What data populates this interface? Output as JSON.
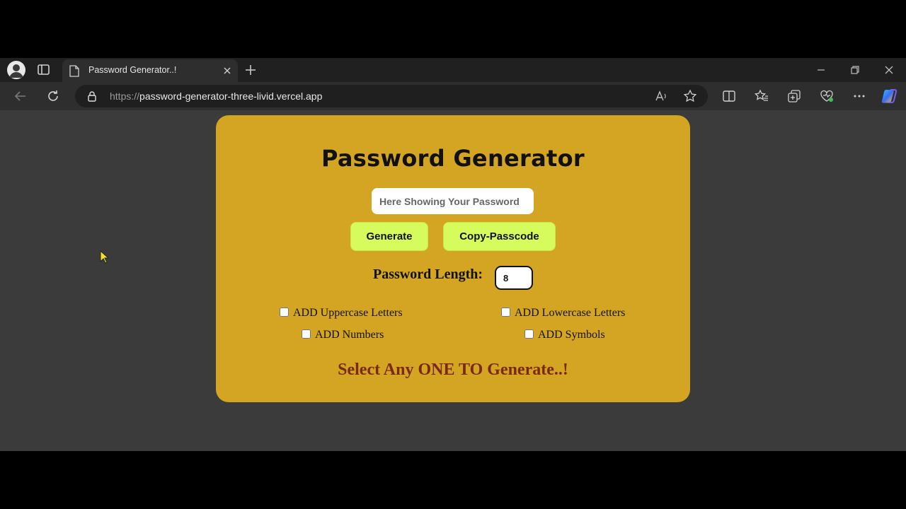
{
  "browser": {
    "tab_title": "Password Generator..!",
    "url_scheme": "https://",
    "url_host": "password-generator-three-livid.vercel.app"
  },
  "page": {
    "heading": "Password Generator",
    "password_placeholder": "Here Showing Your Password",
    "generate_label": "Generate",
    "copy_label": "Copy-Passcode",
    "length_label": "Password Length:",
    "length_value": "8",
    "options": {
      "uppercase": "ADD Uppercase Letters",
      "lowercase": "ADD Lowercase Letters",
      "numbers": "ADD Numbers",
      "symbols": "ADD Symbols"
    },
    "status": "Select Any ONE TO Generate..!"
  },
  "colors": {
    "card": "#d4a523",
    "button": "#d6fb5c",
    "status_text": "#7a2a10",
    "page_bg": "#3b3b3b"
  }
}
